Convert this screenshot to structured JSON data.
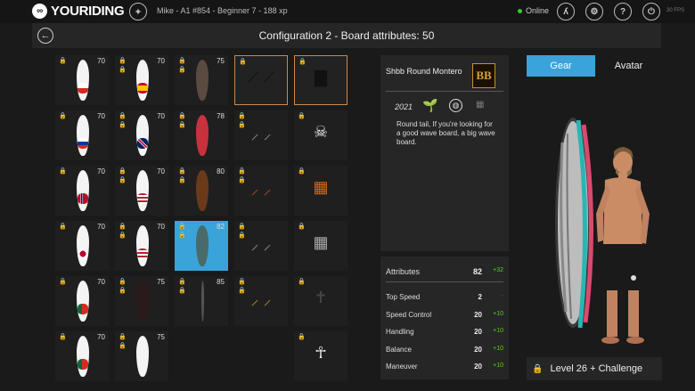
{
  "header": {
    "logo_mark": "∞",
    "logo_text": "YOURIDING",
    "user_info": "Mike - A1 #854 - Beginner 7 - 188 xp",
    "status": "Online",
    "fps": "30 FPS"
  },
  "title": "Configuration 2 - Board attributes: 50",
  "grid": {
    "items": [
      {
        "type": "board",
        "value": "70",
        "color": "#f4f4f4",
        "flag": "chile",
        "col": 0,
        "row": 0
      },
      {
        "type": "board",
        "value": "70",
        "color": "#f4f4f4",
        "flag": "spain",
        "col": 1,
        "row": 0
      },
      {
        "type": "board",
        "value": "75",
        "color": "#5a4a40",
        "flag": "none",
        "col": 2,
        "row": 0,
        "locks": 2
      },
      {
        "type": "gear",
        "value": "",
        "col": 3,
        "row": 0,
        "highlight": true,
        "gear": "fins"
      },
      {
        "type": "gear",
        "value": "",
        "col": 4,
        "row": 0,
        "highlight": true,
        "gear": "wetsuit"
      },
      {
        "type": "board",
        "value": "70",
        "color": "#f4f4f4",
        "flag": "russia",
        "col": 0,
        "row": 1
      },
      {
        "type": "board",
        "value": "70",
        "color": "#f4f4f4",
        "flag": "uk",
        "col": 1,
        "row": 1
      },
      {
        "type": "board",
        "value": "78",
        "color": "#c8323c",
        "flag": "none",
        "col": 2,
        "row": 1,
        "locks": 2
      },
      {
        "type": "gear",
        "value": "",
        "col": 3,
        "row": 1,
        "gear": "fins-small",
        "locks": 2
      },
      {
        "type": "gear",
        "value": "",
        "col": 4,
        "row": 1,
        "gear": "skeleton-top"
      },
      {
        "type": "board",
        "value": "70",
        "color": "#f4f4f4",
        "flag": "norway",
        "col": 0,
        "row": 2
      },
      {
        "type": "board",
        "value": "70",
        "color": "#f4f4f4",
        "flag": "usa",
        "col": 1,
        "row": 2
      },
      {
        "type": "board",
        "value": "80",
        "color": "#6b3a1a",
        "flag": "none",
        "col": 2,
        "row": 2,
        "locks": 2
      },
      {
        "type": "gear",
        "value": "",
        "col": 3,
        "row": 2,
        "gear": "fins-red",
        "locks": 2
      },
      {
        "type": "gear",
        "value": "",
        "col": 4,
        "row": 2,
        "gear": "shorts-orange"
      },
      {
        "type": "board",
        "value": "70",
        "color": "#f4f4f4",
        "flag": "japan",
        "col": 0,
        "row": 3
      },
      {
        "type": "board",
        "value": "70",
        "color": "#f4f4f4",
        "flag": "usa2",
        "col": 1,
        "row": 3
      },
      {
        "type": "board",
        "value": "82",
        "color": "#4a6a6a",
        "flag": "none",
        "col": 2,
        "row": 3,
        "locks": 2,
        "selected": true
      },
      {
        "type": "gear",
        "value": "",
        "col": 3,
        "row": 3,
        "gear": "fins-small",
        "locks": 2
      },
      {
        "type": "gear",
        "value": "",
        "col": 4,
        "row": 3,
        "gear": "shorts-grey"
      },
      {
        "type": "board",
        "value": "70",
        "color": "#f4f4f4",
        "flag": "portugal",
        "col": 0,
        "row": 4
      },
      {
        "type": "board",
        "value": "75",
        "color": "#2a1a1a",
        "flag": "none",
        "col": 1,
        "row": 4
      },
      {
        "type": "board",
        "value": "85",
        "color": "#555",
        "flag": "none",
        "col": 2,
        "row": 4,
        "locks": 2,
        "thin": true
      },
      {
        "type": "gear",
        "value": "",
        "col": 3,
        "row": 4,
        "gear": "fins-gold",
        "locks": 2
      },
      {
        "type": "gear",
        "value": "",
        "col": 4,
        "row": 4,
        "gear": "figure-dark"
      },
      {
        "type": "board",
        "value": "70",
        "color": "#f4f4f4",
        "flag": "portugal2",
        "col": 0,
        "row": 5
      },
      {
        "type": "board",
        "value": "75",
        "color": "#f4f4f4",
        "flag": "none",
        "col": 1,
        "row": 5
      },
      {
        "type": "gear",
        "value": "",
        "col": 4,
        "row": 5,
        "gear": "skeleton-full"
      }
    ]
  },
  "info": {
    "name": "Shbb Round Montero",
    "brand_logo_text": "BB",
    "year": "2021",
    "description": "Round tail, If you're looking for a good wave board, a big wave board."
  },
  "attributes": {
    "header_label": "Attributes",
    "header_value": "82",
    "header_delta": "+32",
    "rows": [
      {
        "label": "Top Speed",
        "value": "2",
        "delta": "-",
        "neg": true
      },
      {
        "label": "Speed Control",
        "value": "20",
        "delta": "+10"
      },
      {
        "label": "Handling",
        "value": "20",
        "delta": "+10"
      },
      {
        "label": "Balance",
        "value": "20",
        "delta": "+10"
      },
      {
        "label": "Maneuver",
        "value": "20",
        "delta": "+10"
      }
    ]
  },
  "tabs": {
    "gear": "Gear",
    "avatar": "Avatar"
  },
  "level": {
    "text": "Level 26 + Challenge"
  },
  "colors": {
    "accent": "#3aa3d9",
    "positive": "#55cc33",
    "negative": "#cc3333",
    "highlight_border": "#c98a4a"
  }
}
